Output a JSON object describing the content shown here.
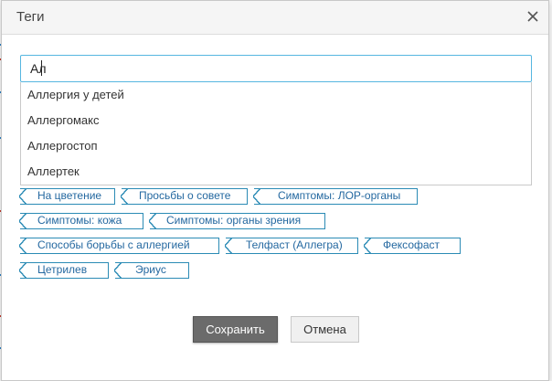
{
  "dialog": {
    "title": "Теги",
    "close_icon": "close-icon"
  },
  "search": {
    "value": "Ал",
    "placeholder": ""
  },
  "suggestions": [
    "Аллергия у детей",
    "Аллергомакс",
    "Аллергостоп",
    "Аллертек"
  ],
  "tags": {
    "row1": [
      "На цветение",
      "Просьбы о совете",
      "Симптомы: ЛОР-органы"
    ],
    "row2": [
      "Симптомы: кожа",
      "Симптомы: органы зрения"
    ],
    "row3": [
      "Способы борьбы с аллергией",
      "Телфаст (Аллегра)",
      "Фексофаст"
    ],
    "row4": [
      "Цетрилев",
      "Эриус"
    ]
  },
  "buttons": {
    "save_label": "Сохранить",
    "cancel_label": "Отмена"
  },
  "colors": {
    "accent": "#2b8bb5",
    "input_focus": "#56b6e0",
    "primary_button": "#6b6b6b"
  }
}
